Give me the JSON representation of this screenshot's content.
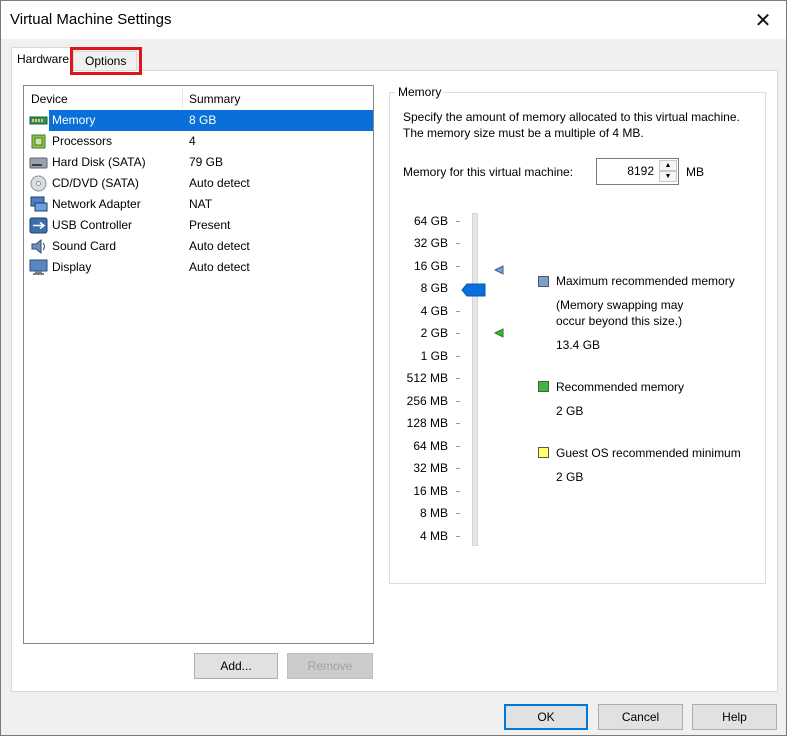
{
  "window": {
    "title": "Virtual Machine Settings"
  },
  "tabs": [
    {
      "label": "Hardware"
    },
    {
      "label": "Options"
    }
  ],
  "device_list": {
    "headers": {
      "device": "Device",
      "summary": "Summary"
    },
    "rows": [
      {
        "name": "Memory",
        "summary": "8 GB",
        "icon": "memory-icon"
      },
      {
        "name": "Processors",
        "summary": "4",
        "icon": "processor-icon"
      },
      {
        "name": "Hard Disk (SATA)",
        "summary": "79 GB",
        "icon": "hard-disk-icon"
      },
      {
        "name": "CD/DVD (SATA)",
        "summary": "Auto detect",
        "icon": "cd-dvd-icon"
      },
      {
        "name": "Network Adapter",
        "summary": "NAT",
        "icon": "network-adapter-icon"
      },
      {
        "name": "USB Controller",
        "summary": "Present",
        "icon": "usb-icon"
      },
      {
        "name": "Sound Card",
        "summary": "Auto detect",
        "icon": "speaker-icon"
      },
      {
        "name": "Display",
        "summary": "Auto detect",
        "icon": "monitor-icon"
      }
    ],
    "add_label": "Add...",
    "remove_label": "Remove"
  },
  "memory": {
    "group_label": "Memory",
    "description": "Specify the amount of memory allocated to this virtual machine. The memory size must be a multiple of 4 MB.",
    "field_label": "Memory for this virtual machine:",
    "value": "8192",
    "unit": "MB",
    "scale": [
      "64 GB",
      "32 GB",
      "16 GB",
      "8 GB",
      "4 GB",
      "2 GB",
      "1 GB",
      "512 MB",
      "256 MB",
      "128 MB",
      "64 MB",
      "32 MB",
      "16 MB",
      "8 MB",
      "4 MB"
    ],
    "legend": {
      "max_title": "Maximum recommended memory",
      "max_note_1": "(Memory swapping may",
      "max_note_2": "occur beyond this size.)",
      "max_value": "13.4 GB",
      "rec_title": "Recommended memory",
      "rec_value": "2 GB",
      "guest_title": "Guest OS recommended minimum",
      "guest_value": "2 GB"
    },
    "colors": {
      "max": "#7b9fd0",
      "recommended": "#3cb93c",
      "guest_min": "#ffff66",
      "slider": "#0a6fd8"
    }
  },
  "footer": {
    "ok": "OK",
    "cancel": "Cancel",
    "help": "Help"
  }
}
